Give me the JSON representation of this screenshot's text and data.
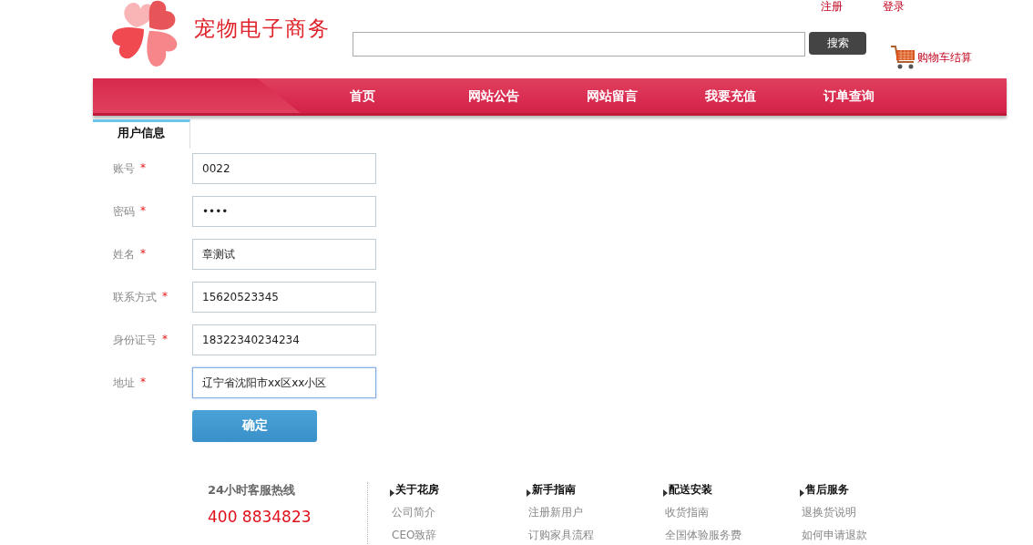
{
  "header": {
    "site_title": "宠物电子商务",
    "top_links": [
      "注册",
      "登录"
    ],
    "search": {
      "button": "搜索"
    },
    "cart_link": "购物车结算"
  },
  "nav": {
    "items": [
      "首页",
      "网站公告",
      "网站留言",
      "我要充值",
      "订单查询"
    ]
  },
  "tab": {
    "label": "用户信息",
    "selected": true
  },
  "form": {
    "fields": [
      {
        "label": "账号",
        "mark": "*",
        "value": "0022",
        "focused": false
      },
      {
        "label": "密码",
        "mark": "*",
        "value": "••••",
        "focused": false
      },
      {
        "label": "姓名",
        "mark": "*",
        "value": "章测试",
        "focused": false
      },
      {
        "label": "联系方式",
        "mark": "*",
        "value": "15620523345",
        "focused": false
      },
      {
        "label": "身份证号",
        "mark": "*",
        "value": "18322340234234",
        "focused": false
      },
      {
        "label": "地址",
        "mark": "*",
        "value": "辽宁省沈阳市xx区xx小区",
        "focused": true
      }
    ],
    "submit": "确定"
  },
  "footer": {
    "hotline_label": "24小时客服热线",
    "hotline_number": "400 8834823",
    "columns": [
      {
        "title": "关于花房",
        "links": [
          "公司简介",
          "CEO致辞"
        ]
      },
      {
        "title": "新手指南",
        "links": [
          "注册新用户",
          "订购家具流程"
        ]
      },
      {
        "title": "配送安装",
        "links": [
          "收货指南",
          "全国体验服务费"
        ]
      },
      {
        "title": "售后服务",
        "links": [
          "退换货说明",
          "如何申请退款"
        ]
      }
    ]
  }
}
